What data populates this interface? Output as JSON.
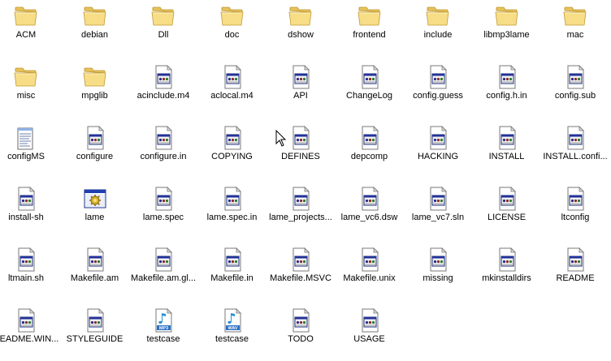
{
  "view": {
    "mode": "icons",
    "background": "#ffffff"
  },
  "files": [
    {
      "label": "ACM",
      "icon": "folder-icon"
    },
    {
      "label": "debian",
      "icon": "folder-icon"
    },
    {
      "label": "Dll",
      "icon": "folder-icon"
    },
    {
      "label": "doc",
      "icon": "folder-icon"
    },
    {
      "label": "dshow",
      "icon": "folder-icon"
    },
    {
      "label": "frontend",
      "icon": "folder-icon"
    },
    {
      "label": "include",
      "icon": "folder-icon"
    },
    {
      "label": "libmp3lame",
      "icon": "folder-icon"
    },
    {
      "label": "mac",
      "icon": "folder-icon"
    },
    {
      "label": "misc",
      "icon": "folder-icon"
    },
    {
      "label": "mpglib",
      "icon": "folder-icon"
    },
    {
      "label": "acinclude.m4",
      "icon": "document-icon"
    },
    {
      "label": "aclocal.m4",
      "icon": "document-icon"
    },
    {
      "label": "API",
      "icon": "document-icon"
    },
    {
      "label": "ChangeLog",
      "icon": "document-icon"
    },
    {
      "label": "config.guess",
      "icon": "document-icon"
    },
    {
      "label": "config.h.in",
      "icon": "document-icon"
    },
    {
      "label": "config.sub",
      "icon": "document-icon"
    },
    {
      "label": "configMS",
      "icon": "notepad-icon"
    },
    {
      "label": "configure",
      "icon": "document-icon"
    },
    {
      "label": "configure.in",
      "icon": "document-icon"
    },
    {
      "label": "COPYING",
      "icon": "document-icon"
    },
    {
      "label": "DEFINES",
      "icon": "document-icon"
    },
    {
      "label": "depcomp",
      "icon": "document-icon"
    },
    {
      "label": "HACKING",
      "icon": "document-icon"
    },
    {
      "label": "INSTALL",
      "icon": "document-icon"
    },
    {
      "label": "INSTALL.confi...",
      "icon": "document-icon"
    },
    {
      "label": "install-sh",
      "icon": "document-icon"
    },
    {
      "label": "lame",
      "icon": "executable-icon"
    },
    {
      "label": "lame.spec",
      "icon": "document-icon"
    },
    {
      "label": "lame.spec.in",
      "icon": "document-icon"
    },
    {
      "label": "lame_projects...",
      "icon": "document-icon"
    },
    {
      "label": "lame_vc6.dsw",
      "icon": "document-icon"
    },
    {
      "label": "lame_vc7.sln",
      "icon": "document-icon"
    },
    {
      "label": "LICENSE",
      "icon": "document-icon"
    },
    {
      "label": "ltconfig",
      "icon": "document-icon"
    },
    {
      "label": "ltmain.sh",
      "icon": "document-icon"
    },
    {
      "label": "Makefile.am",
      "icon": "document-icon"
    },
    {
      "label": "Makefile.am.gl...",
      "icon": "document-icon"
    },
    {
      "label": "Makefile.in",
      "icon": "document-icon"
    },
    {
      "label": "Makefile.MSVC",
      "icon": "document-icon"
    },
    {
      "label": "Makefile.unix",
      "icon": "document-icon"
    },
    {
      "label": "missing",
      "icon": "document-icon"
    },
    {
      "label": "mkinstalldirs",
      "icon": "document-icon"
    },
    {
      "label": "README",
      "icon": "document-icon"
    },
    {
      "label": "README.WIN...",
      "icon": "document-icon"
    },
    {
      "label": "STYLEGUIDE",
      "icon": "document-icon"
    },
    {
      "label": "testcase",
      "icon": "mp3-audio-icon",
      "badge": "MP3"
    },
    {
      "label": "testcase",
      "icon": "wav-audio-icon",
      "badge": "WAV"
    },
    {
      "label": "TODO",
      "icon": "document-icon"
    },
    {
      "label": "USAGE",
      "icon": "document-icon"
    }
  ],
  "cursor": {
    "icon": "mouse-pointer-icon"
  }
}
